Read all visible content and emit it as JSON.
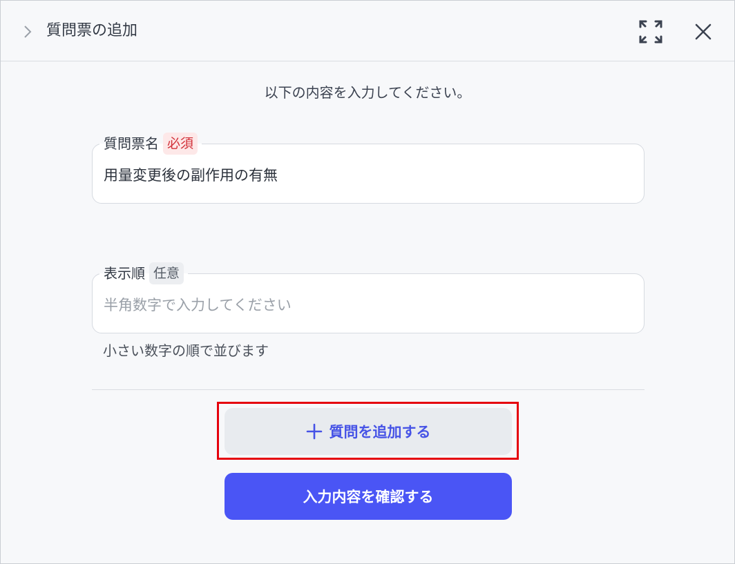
{
  "header": {
    "title": "質問票の追加",
    "chevron_icon": "chevron-right-icon",
    "expand_icon": "expand-icon",
    "close_icon": "close-icon"
  },
  "instruction": "以下の内容を入力してください。",
  "form": {
    "name_field": {
      "label": "質問票名",
      "badge": "必須",
      "value": "用量変更後の副作用の有無"
    },
    "order_field": {
      "label": "表示順",
      "badge": "任意",
      "value": "",
      "placeholder": "半角数字で入力してください",
      "helper": "小さい数字の順で並びます"
    }
  },
  "buttons": {
    "add_question": "質問を追加する",
    "add_icon": "plus-icon",
    "confirm": "入力内容を確認する"
  },
  "colors": {
    "accent": "#4a55f5",
    "required_badge": "#d2323a",
    "highlight_border": "#e5000c"
  }
}
